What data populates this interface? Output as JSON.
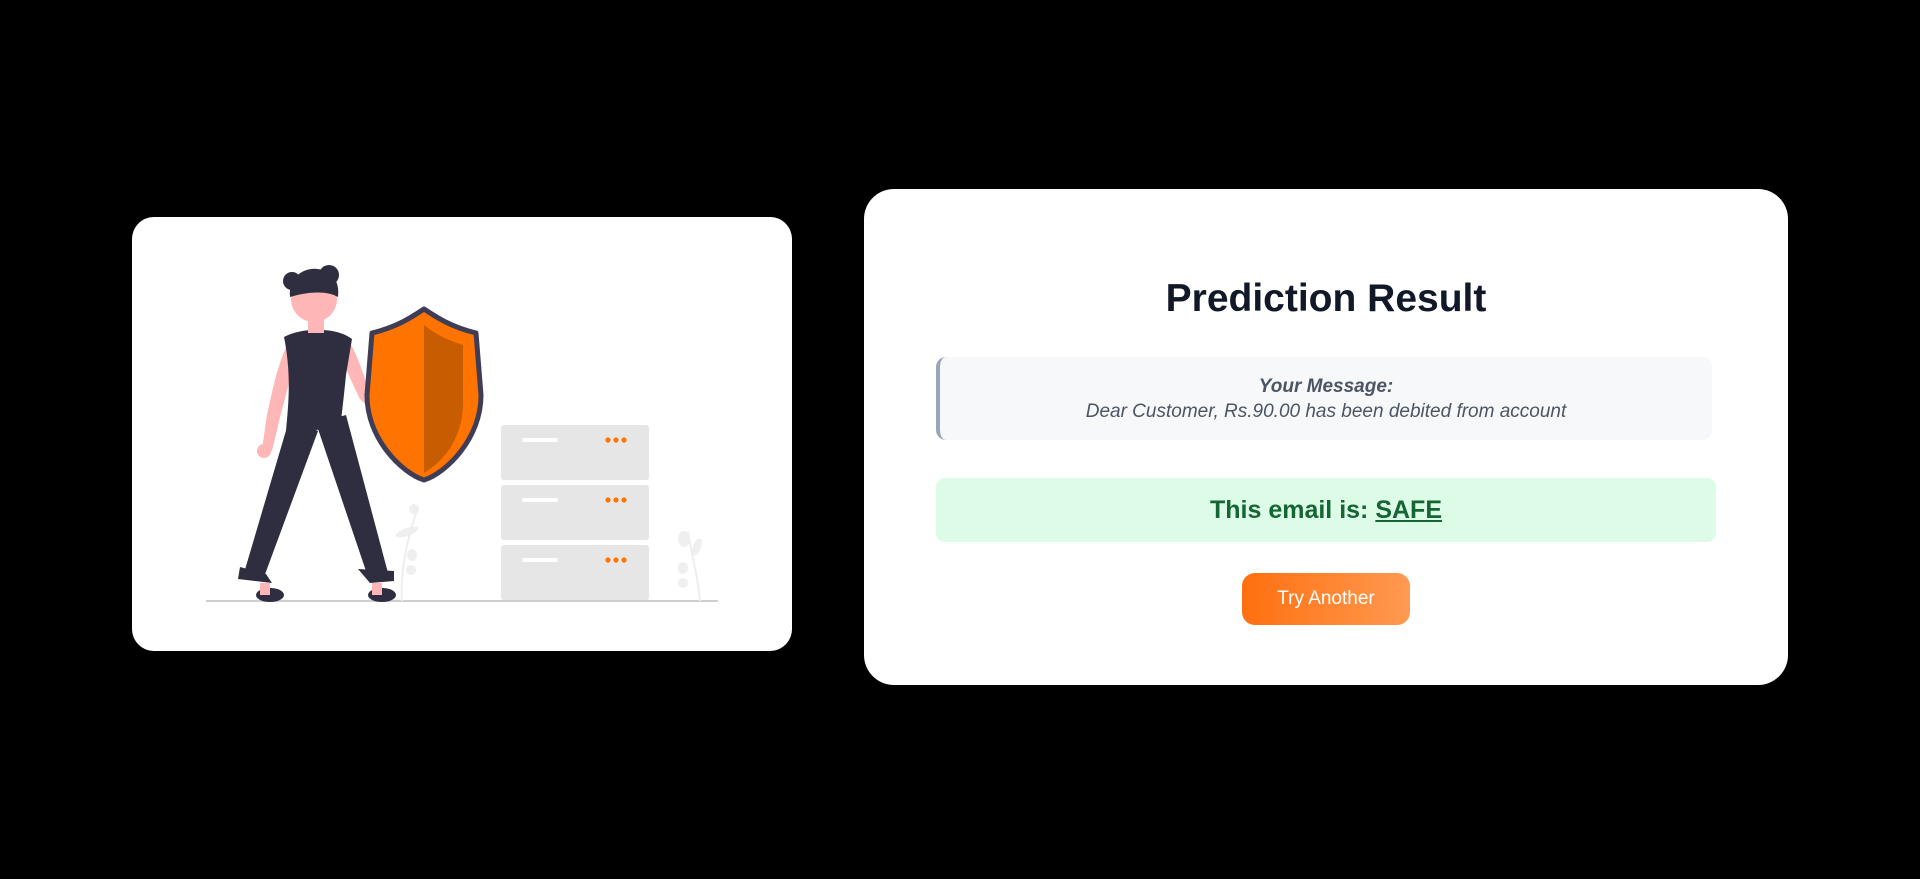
{
  "illustration": {
    "description_icon": "security-shield-illustration",
    "colors": {
      "accent": "#ff7300",
      "dark": "#2f2e41",
      "skin": "#ffb6b6",
      "server": "#e6e6e6"
    }
  },
  "result": {
    "title": "Prediction Result",
    "message_label": "Your Message:",
    "message_text": "Dear Customer, Rs.90.00 has been debited from account",
    "verdict_prefix": "This email is: ",
    "verdict_value": "SAFE",
    "verdict_color": "#166534",
    "try_again_label": "Try Another"
  }
}
